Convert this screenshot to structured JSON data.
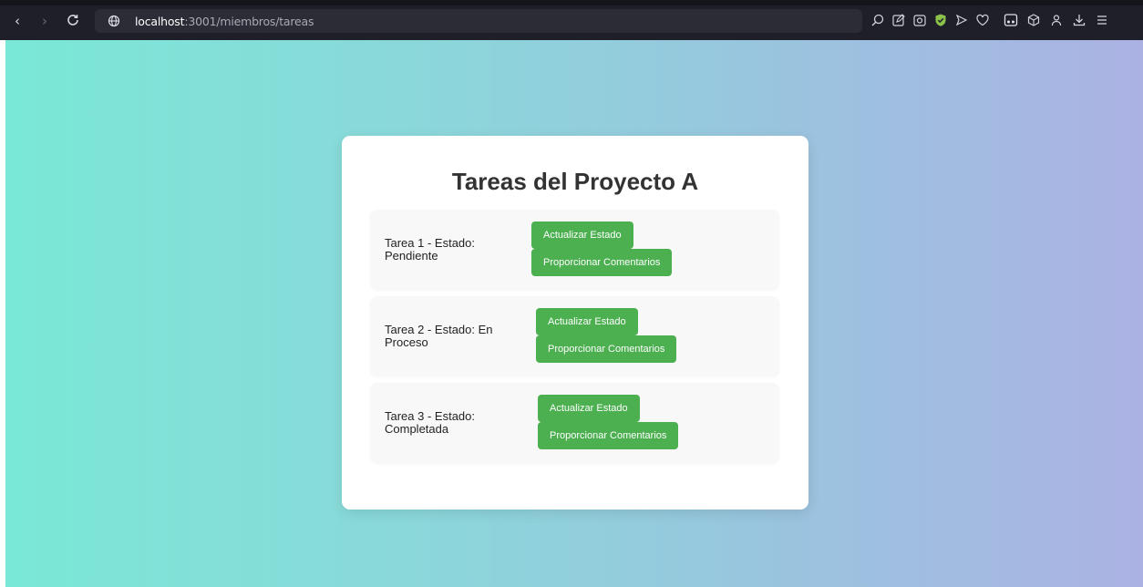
{
  "browser": {
    "url_host": "localhost",
    "url_path": ":3001/miembros/tareas",
    "icons": [
      "back-icon",
      "forward-icon",
      "reload-icon",
      "site-info-icon",
      "search-page-icon",
      "edit-icon",
      "screenshot-icon",
      "shield-extension-icon",
      "send-icon",
      "favorite-icon",
      "extension-icon",
      "box-icon",
      "profile-icon",
      "download-icon",
      "menu-icon"
    ]
  },
  "page": {
    "title": "Tareas del Proyecto A",
    "tasks": [
      {
        "line1": "Tarea 1 - Estado:",
        "line2": "Pendiente",
        "update_label": "Actualizar Estado",
        "comment_label": "Proporcionar Comentarios"
      },
      {
        "line1": "Tarea 2 - Estado: En",
        "line2": "Proceso",
        "update_label": "Actualizar Estado",
        "comment_label": "Proporcionar Comentarios"
      },
      {
        "line1": "Tarea 3 - Estado:",
        "line2": "Completada",
        "update_label": "Actualizar Estado",
        "comment_label": "Proporcionar Comentarios"
      }
    ]
  },
  "colors": {
    "button_green": "#4caf50",
    "background_gradient": [
      "#7ae8d6",
      "#abb2e3"
    ],
    "card": "#ffffff",
    "task_background": "#f8f8f8"
  }
}
